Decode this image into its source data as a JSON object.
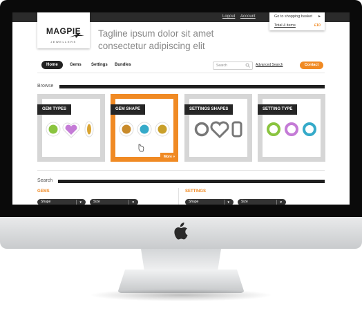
{
  "topbar": {
    "logout": "Logout",
    "account": "Account"
  },
  "basket": {
    "label": "Go to shopping basket",
    "items": "Total 4 items",
    "total": "£10"
  },
  "logo": {
    "brand": "MAGPIE",
    "sub": "JEWELLERS"
  },
  "tagline": {
    "line1": "Tagline ipsum dolor sit amet",
    "line2": "consectetur adipiscing elit"
  },
  "nav": {
    "items": [
      "Home",
      "Gems",
      "Settings",
      "Bundles"
    ],
    "active": "Home"
  },
  "search": {
    "placeholder": "Search",
    "advanced": "Advanced Search"
  },
  "contact": "Contact",
  "browse": {
    "title": "Browse",
    "cards": [
      {
        "label": "GEM TYPES",
        "icons": [
          "green-round-gem-icon",
          "purple-heart-gem-icon",
          "amber-oval-gem-icon"
        ]
      },
      {
        "label": "GEM SHAPE",
        "selected": true,
        "more": "More »",
        "icons": [
          "amber-round-gem-icon",
          "blue-round-gem-icon",
          "gold-round-gem-icon"
        ]
      },
      {
        "label": "SETTINGS SHAPES",
        "icons": [
          "ring-setting-icon",
          "heart-setting-icon",
          "rectangle-setting-icon"
        ]
      },
      {
        "label": "SETTING TYPE",
        "icons": [
          "green-ring-icon",
          "purple-ring-icon",
          "blue-ring-icon"
        ]
      }
    ]
  },
  "search_section": {
    "title": "Search",
    "gems": {
      "title": "GEMS",
      "shape": "Shape",
      "size": "Size"
    },
    "settings": {
      "title": "SETTINGS",
      "shape": "Shape",
      "size": "Size"
    }
  },
  "colors": {
    "accent": "#f08a24",
    "dark": "#222222",
    "frame": "#d6d6d6"
  }
}
